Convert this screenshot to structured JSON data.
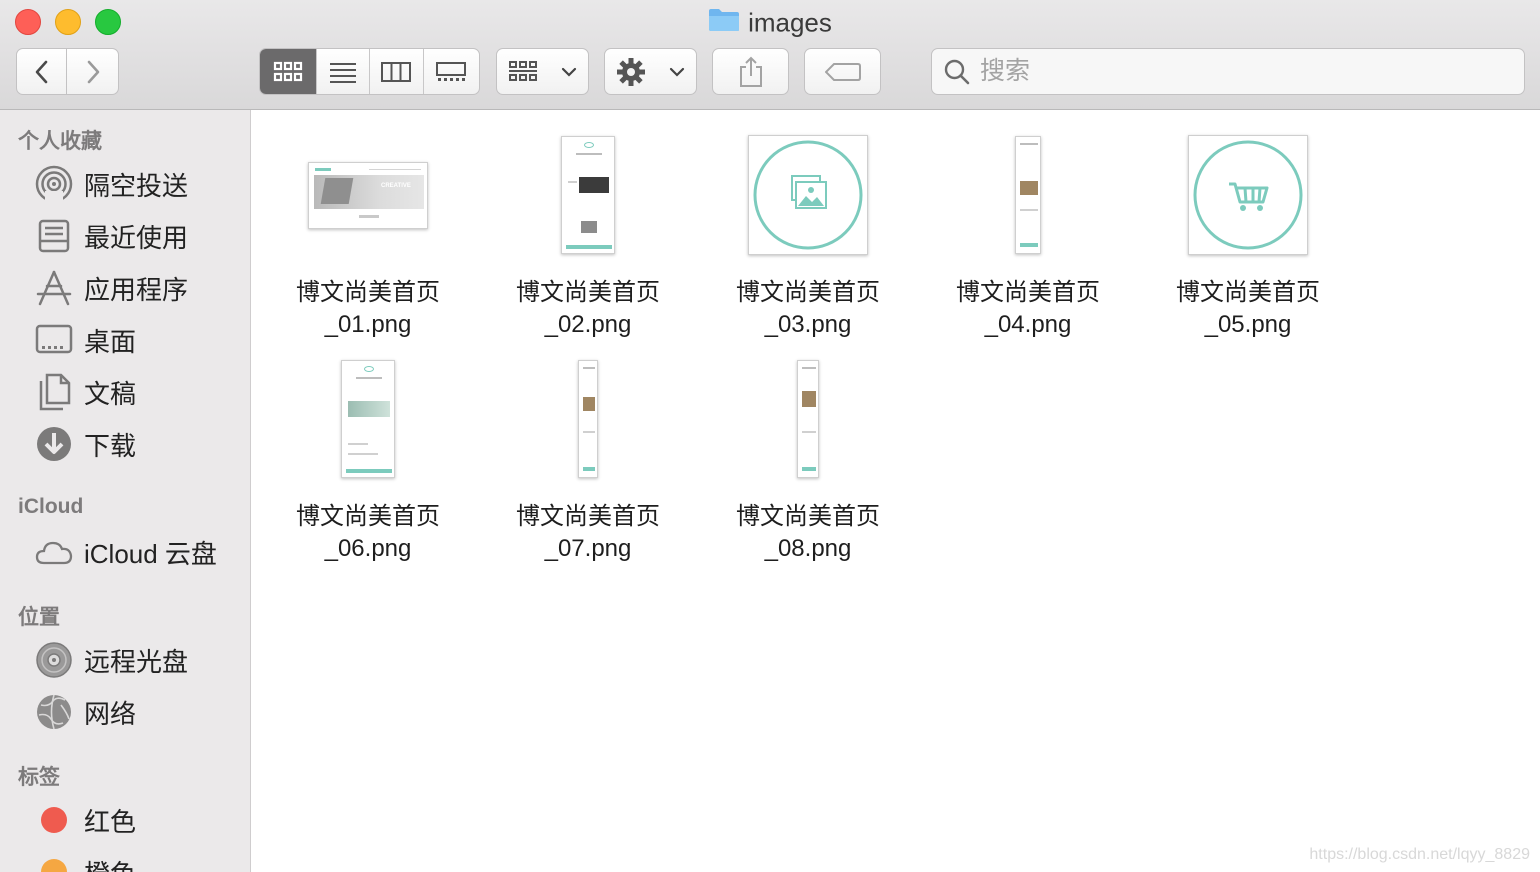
{
  "window": {
    "title": "images",
    "nav": {
      "back_icon": "chevron-left-icon",
      "forward_icon": "chevron-right-icon"
    },
    "view_modes": [
      "icon-view-icon",
      "list-view-icon",
      "column-view-icon",
      "gallery-view-icon"
    ],
    "search": {
      "placeholder": "搜索"
    }
  },
  "sidebar": {
    "favorites_header": "个人收藏",
    "favorites": [
      {
        "label": "隔空投送",
        "icon": "airdrop-icon"
      },
      {
        "label": "最近使用",
        "icon": "recents-icon"
      },
      {
        "label": "应用程序",
        "icon": "applications-icon"
      },
      {
        "label": "桌面",
        "icon": "desktop-icon"
      },
      {
        "label": "文稿",
        "icon": "documents-icon"
      },
      {
        "label": "下载",
        "icon": "downloads-icon"
      }
    ],
    "icloud_header": "iCloud",
    "icloud": [
      {
        "label": "iCloud 云盘",
        "icon": "cloud-icon"
      }
    ],
    "locations_header": "位置",
    "locations": [
      {
        "label": "远程光盘",
        "icon": "disc-icon"
      },
      {
        "label": "网络",
        "icon": "network-icon"
      }
    ],
    "tags_header": "标签",
    "tags": [
      {
        "label": "红色",
        "color": "#ef5b4f"
      },
      {
        "label": "橙色",
        "color": "#f5a742"
      }
    ]
  },
  "files": [
    {
      "name_line1": "博文尚美首页",
      "name_line2": "_01.png"
    },
    {
      "name_line1": "博文尚美首页",
      "name_line2": "_02.png"
    },
    {
      "name_line1": "博文尚美首页",
      "name_line2": "_03.png"
    },
    {
      "name_line1": "博文尚美首页",
      "name_line2": "_04.png"
    },
    {
      "name_line1": "博文尚美首页",
      "name_line2": "_05.png"
    },
    {
      "name_line1": "博文尚美首页",
      "name_line2": "_06.png"
    },
    {
      "name_line1": "博文尚美首页",
      "name_line2": "_07.png"
    },
    {
      "name_line1": "博文尚美首页",
      "name_line2": "_08.png"
    }
  ],
  "thumb_texts": {
    "creative": "CREATIVE"
  },
  "watermark": "https://blog.csdn.net/lqyy_8829",
  "colors": {
    "accent_teal": "#7ccbbd",
    "sidebar_bg": "#ebe9ea"
  }
}
